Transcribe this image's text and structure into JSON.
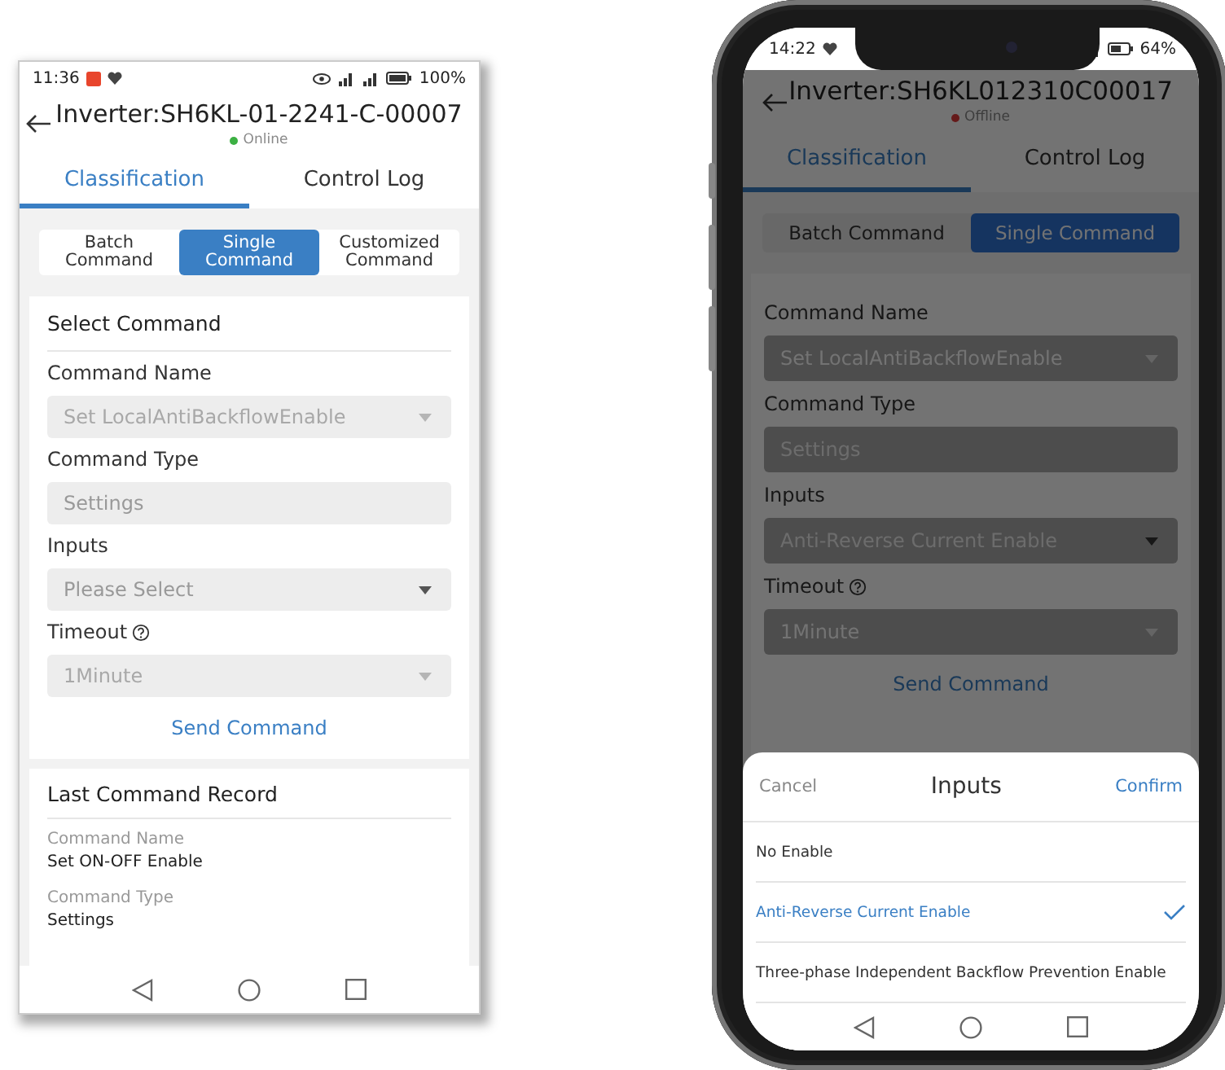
{
  "left_phone": {
    "status_bar": {
      "time": "11:36",
      "battery": "100%"
    },
    "header": {
      "title": "Inverter:SH6KL-01-2241-C-00007",
      "status": "Online",
      "online": true
    },
    "tabs": [
      {
        "label": "Classification",
        "selected": true
      },
      {
        "label": "Control Log",
        "selected": false
      }
    ],
    "command_modes": [
      {
        "label": "Batch Command",
        "selected": false
      },
      {
        "label": "Single Command",
        "selected": true
      },
      {
        "label": "Customized Command",
        "selected": false
      }
    ],
    "select_command": {
      "title": "Select Command",
      "fields": [
        {
          "label": "Command Name",
          "value": "Set LocalAntiBackflowEnable",
          "kind": "dropdown",
          "disabled": true
        },
        {
          "label": "Command Type",
          "value": "Settings",
          "kind": "text"
        },
        {
          "label": "Inputs",
          "placeholder": "Please Select",
          "kind": "dropdown",
          "disabled": false
        },
        {
          "label": "Timeout",
          "value": "1Minute",
          "kind": "dropdown",
          "disabled": true,
          "help": true
        }
      ],
      "send_button": "Send Command"
    },
    "last_command_record": {
      "title": "Last Command Record",
      "items": [
        {
          "label": "Command Name",
          "value": "Set ON-OFF Enable"
        },
        {
          "label": "Command Type",
          "value": "Settings"
        }
      ]
    }
  },
  "right_phone": {
    "status_bar": {
      "time": "14:22",
      "battery": "64%"
    },
    "header": {
      "title": "Inverter:SH6KL012310C00017",
      "status": "Offline",
      "online": false
    },
    "tabs": [
      {
        "label": "Classification",
        "selected": true
      },
      {
        "label": "Control Log",
        "selected": false
      }
    ],
    "command_modes": [
      {
        "label": "Batch Command",
        "selected": false
      },
      {
        "label": "Single Command",
        "selected": true
      }
    ],
    "select_command": {
      "fields": [
        {
          "label": "Command Name",
          "value": "Set LocalAntiBackflowEnable",
          "kind": "dropdown",
          "disabled": true
        },
        {
          "label": "Command Type",
          "value": "Settings",
          "kind": "text"
        },
        {
          "label": "Inputs",
          "value": "Anti-Reverse Current Enable",
          "kind": "dropdown",
          "disabled": false
        },
        {
          "label": "Timeout",
          "value": "1Minute",
          "kind": "dropdown",
          "disabled": true,
          "help": true
        }
      ],
      "send_button": "Send Command"
    },
    "inputs_sheet": {
      "cancel": "Cancel",
      "title": "Inputs",
      "confirm": "Confirm",
      "options": [
        {
          "label": "No Enable",
          "selected": false
        },
        {
          "label": "Anti-Reverse Current Enable",
          "selected": true
        },
        {
          "label": "Three-phase Independent Backflow Prevention Enable",
          "selected": false
        }
      ]
    }
  }
}
